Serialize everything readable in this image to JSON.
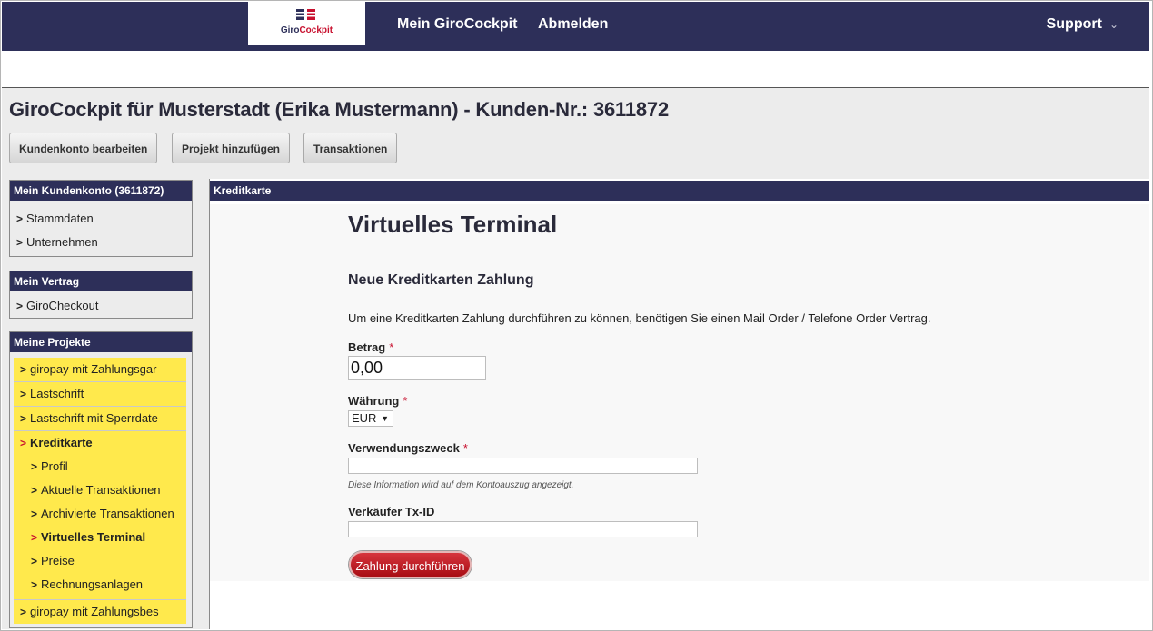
{
  "topnav": {
    "logo_text_1": "Giro",
    "logo_text_2": "Cockpit",
    "link_1": "Mein GiroCockpit",
    "link_2": "Abmelden",
    "support": "Support",
    "support_chevron": "⌄"
  },
  "header": {
    "title": "GiroCockpit für Musterstadt (Erika Mustermann) - Kunden-Nr.: 3611872",
    "buttons": [
      "Kundenkonto bearbeiten",
      "Projekt hinzufügen",
      "Transaktionen"
    ]
  },
  "sidebar": {
    "account": {
      "title": "Mein Kundenkonto (3611872)",
      "items": [
        "Stammdaten",
        "Unternehmen"
      ]
    },
    "contract": {
      "title": "Mein Vertrag",
      "items": [
        "GiroCheckout"
      ]
    },
    "projects": {
      "title": "Meine Projekte",
      "items": [
        "giropay mit Zahlungsgar",
        "Lastschrift",
        "Lastschrift mit Sperrdate",
        "Kreditkarte"
      ],
      "subitems": [
        "Profil",
        "Aktuelle Transaktionen",
        "Archivierte Transaktionen",
        "Virtuelles Terminal",
        "Preise",
        "Rechnungsanlagen"
      ],
      "last_item": "giropay mit Zahlungsbes",
      "active_item": "Kreditkarte",
      "active_subitem": "Virtuelles Terminal"
    }
  },
  "main": {
    "section_title": "Kreditkarte",
    "heading": "Virtuelles Terminal",
    "subheading": "Neue Kreditkarten Zahlung",
    "intro": "Um eine Kreditkarten Zahlung durchführen zu können, benötigen Sie einen Mail Order / Telefone Order Vertrag.",
    "required_mark": "*",
    "amount_label": "Betrag",
    "amount_value": "0,00",
    "currency_label": "Währung",
    "currency_value": "EUR",
    "purpose_label": "Verwendungszweck",
    "purpose_value": "",
    "purpose_hint": "Diese Information wird auf dem Kontoauszug angezeigt.",
    "txid_label": "Verkäufer Tx-ID",
    "txid_value": "",
    "submit": "Zahlung durchführen"
  },
  "colors": {
    "navy": "#2d2f59",
    "project_highlight": "#ffe94c",
    "accent_red": "#c8102e"
  }
}
